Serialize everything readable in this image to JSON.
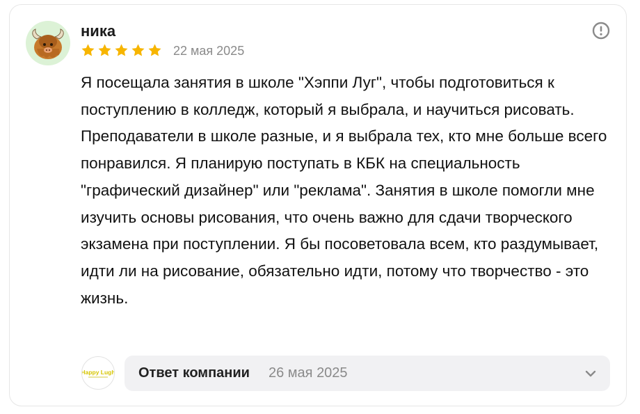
{
  "review": {
    "author": "ника",
    "rating": 5,
    "rating_max": 5,
    "date": "22 мая 2025",
    "text": "Я посещала занятия в школе \"Хэппи Луг\", чтобы подготовиться к поступлению в колледж, который я выбрала, и научиться рисовать. Преподаватели в школе разные, и я выбрала тех, кто мне больше всего понравился. Я планирую поступать в КБК на специальность \"графический дизайнер\" или \"реклама\". Занятия в школе помогли мне изучить основы рисования, что очень важно для сдачи творческого экзамена при поступлении. Я бы посоветовала всем, кто раздумывает, идти ли на рисование, обязательно идти, потому что творчество - это жизнь."
  },
  "company_reply": {
    "label": "Ответ компании",
    "date": "26 мая 2025",
    "logo_text": "Happy Lugh"
  },
  "icons": {
    "avatar": "yak-avatar",
    "star": "star-icon",
    "report": "exclamation-circle-icon",
    "expand": "chevron-down-icon"
  },
  "colors": {
    "star": "#f7b500",
    "avatar_bg": "#dcf2d6",
    "reply_bg": "#f1f1f3",
    "muted_text": "#8a8a8a"
  }
}
